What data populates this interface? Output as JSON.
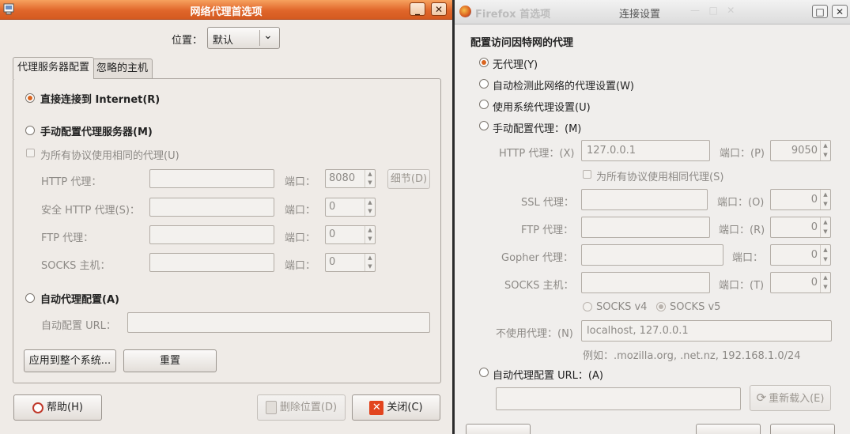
{
  "left_window": {
    "title": "网络代理首选项",
    "location_label": "位置：",
    "location_value": "默认",
    "tabs": [
      "代理服务器配置",
      "忽略的主机"
    ],
    "direct_label": "直接连接到 Internet(R)",
    "manual_label": "手动配置代理服务器(M)",
    "same_proxy_label": "为所有协议使用相同的代理(U)",
    "http_label": "HTTP 代理：",
    "secure_http_label": "安全 HTTP 代理(S)：",
    "ftp_label": "FTP 代理：",
    "socks_label": "SOCKS 主机：",
    "port_label": "端口：",
    "http_port": "8080",
    "secure_port": "0",
    "ftp_port": "0",
    "socks_port": "0",
    "details_button": "细节(D)",
    "auto_label": "自动代理配置(A)",
    "auto_url_label": "自动配置 URL：",
    "apply_button": "应用到整个系统...",
    "reset_button": "重置",
    "help_button": "帮助(H)",
    "delete_location_button": "删除位置(D)",
    "close_button": "关闭(C)"
  },
  "right_window": {
    "behind_title": "Firefox 首选项",
    "title": "连接设置",
    "heading": "配置访问因特网的代理",
    "no_proxy": "无代理(Y)",
    "auto_detect": "自动检测此网络的代理设置(W)",
    "system_proxy": "使用系统代理设置(U)",
    "manual_proxy": "手动配置代理：(M)",
    "http_label": "HTTP 代理：(X)",
    "http_value": "127.0.0.1",
    "port_p": "端口：(P)",
    "http_port": "9050",
    "same_proxy": "为所有协议使用相同代理(S)",
    "ssl_label": "SSL 代理：",
    "port_o": "端口：(O)",
    "ssl_port": "0",
    "ftp_label": "FTP 代理：",
    "port_r": "端口：(R)",
    "ftp_port": "0",
    "gopher_label": "Gopher 代理：",
    "port_plain": "端口：",
    "gopher_port": "0",
    "socks_label": "SOCKS 主机：",
    "port_t": "端口：(T)",
    "socks_port": "0",
    "socks_v4": "SOCKS v4",
    "socks_v5": "SOCKS v5",
    "no_proxy_for_label": "不使用代理：(N)",
    "no_proxy_for_value": "localhost, 127.0.0.1",
    "example": "例如：.mozilla.org, .net.nz, 192.168.1.0/24",
    "auto_url_label": "自动代理配置 URL：(A)",
    "reload_button": "重新载入(E)"
  },
  "colors": {
    "titlebar": "#e0662a",
    "window_bg": "#efebe7",
    "radio_on": "#d9641f"
  }
}
